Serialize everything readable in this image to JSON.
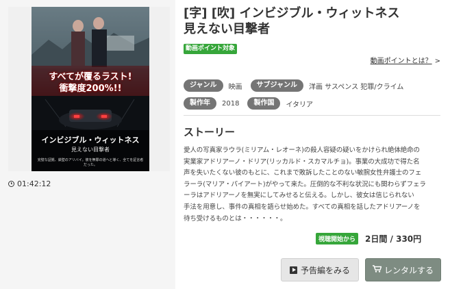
{
  "movie": {
    "title_line1": "[字] [吹] インビジブル・ウィットネス",
    "title_line2": "見えない目撃者",
    "point_badge": "動画ポイント対象",
    "point_link": "動画ポイントとは？",
    "point_link_chevron": ">",
    "duration": "01:42:12"
  },
  "poster": {
    "tagline_line1": "すべてが覆るラスト!",
    "tagline_line2": "衝撃度200%!!",
    "title": "インビジブル・ウィットネス",
    "subtitle": "見えない目撃者",
    "caption": "完璧な証拠、鉄壁のアリバイ。彼を無罪の道へと導く、全てを証言者だった。"
  },
  "meta": {
    "genre_label": "ジャンル",
    "genre_value": "映画",
    "subgenre_label": "サブジャンル",
    "subgenre_value": "洋画 サスペンス 犯罪/クライム",
    "year_label": "製作年",
    "year_value": "2018",
    "country_label": "製作国",
    "country_value": "イタリア"
  },
  "story": {
    "heading": "ストーリー",
    "lines": [
      "愛人の写真家ラウラ(ミリアム・レオーネ)の殺人容疑の疑いをかけられ絶体絶命の",
      "実業家アドリアーノ・ドリア(リッカルド・スカマルチョ)。事業の大成功で得た名",
      "声を失いたくない彼のもとに、これまで敗訴したことのない敏腕女性弁護士のフェ",
      "ラーラ(マリア・パイアート)がやって来た。圧倒的な不利な状況にも関わらずフェラ",
      "ーラはアドリアーノを無実にしてみせると伝える。しかし、彼女は信じられない",
      "手法を用意し、事件の真相を語らせ始めた。すべての真相を話したアドリアーノを",
      "待ち受けるものとは・・・・・・。"
    ]
  },
  "price": {
    "badge": "視聴開始から",
    "text": "2日間 / 330円"
  },
  "buttons": {
    "trailer": "予告編をみる",
    "rent": "レンタルする"
  },
  "icons": {
    "clock": "clock-icon",
    "play": "play-icon",
    "cart": "cart-icon"
  },
  "colors": {
    "accent_green": "#36a63a",
    "pill_gray": "#757575",
    "rent_button": "#7e8c82"
  }
}
